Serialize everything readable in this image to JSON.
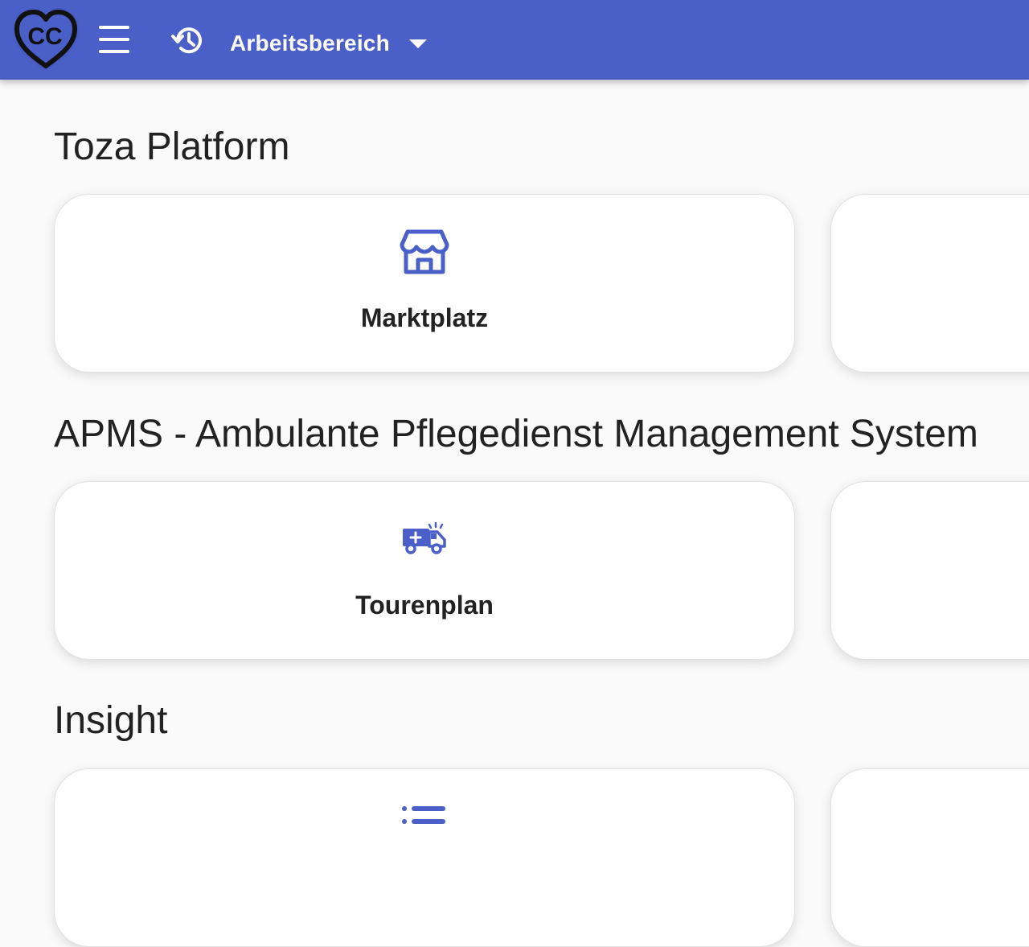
{
  "header": {
    "logo_text": "CC",
    "workspace_label": "Arbeitsbereich",
    "icons": [
      "heart-logo",
      "menu-icon",
      "history-icon",
      "caret-down-icon"
    ],
    "bar_color": "#4a5fc7"
  },
  "sections": [
    {
      "title": "Toza Platform",
      "card_label": "Marktplatz",
      "icon": "storefront-icon"
    },
    {
      "title": "APMS - Ambulante Pflegedienst Management System",
      "card_label": "Tourenplan",
      "icon": "ambulance-icon"
    },
    {
      "title": "Insight",
      "card_label": "",
      "icon": "list-icon"
    }
  ],
  "accent_color": "#4a5fc7"
}
